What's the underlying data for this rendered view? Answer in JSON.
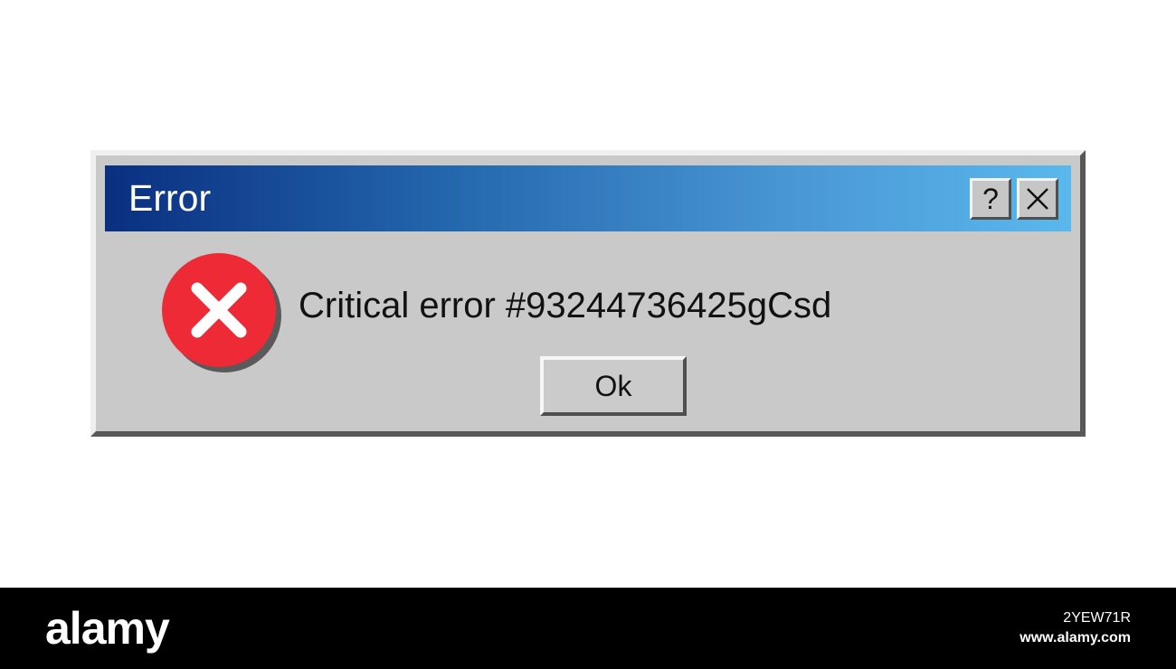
{
  "dialog": {
    "title": "Error",
    "help_button_label": "?",
    "close_icon": "close-icon",
    "status_icon": "error-x-icon",
    "message": "Critical error #93244736425gCsd",
    "ok_button_label": "Ok"
  },
  "banner": {
    "logo": "alamy",
    "image_id": "2YEW71R",
    "url": "www.alamy.com"
  },
  "colors": {
    "titlebar_start": "#0a2f80",
    "titlebar_end": "#5ab8ec",
    "window_face": "#c9c9c9",
    "error_red": "#ee2a36",
    "banner_bg": "#000000"
  }
}
